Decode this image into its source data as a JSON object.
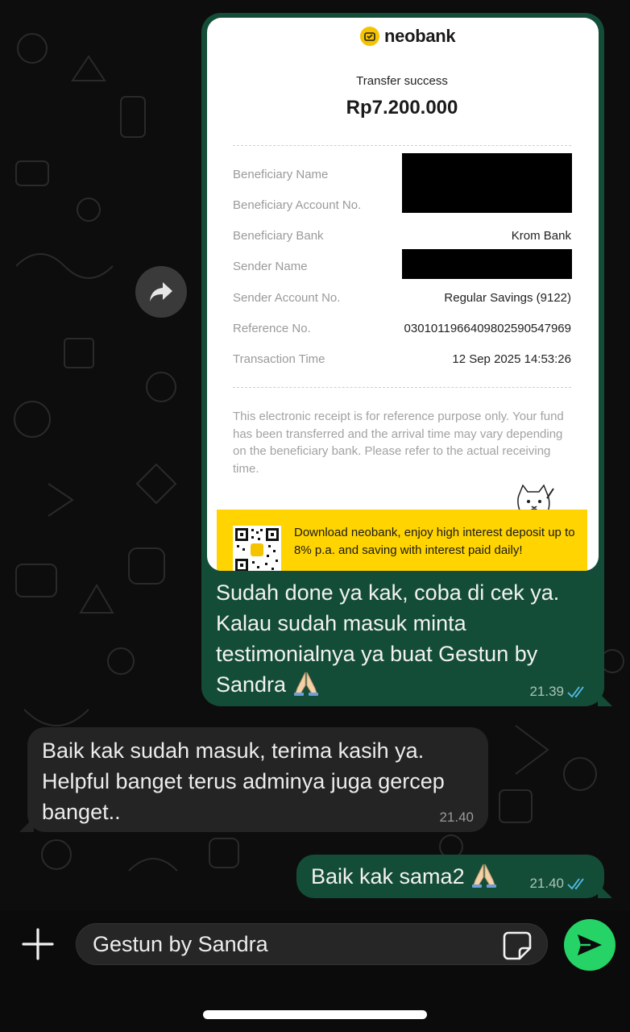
{
  "colors": {
    "outgoing_bubble": "#144d37",
    "incoming_bubble": "#242424",
    "send_button": "#25d366",
    "read_ticks": "#53bdeb",
    "promo_yellow": "#ffd400"
  },
  "receipt": {
    "brand": "neobank",
    "status": "Transfer success",
    "amount": "Rp7.200.000",
    "rows": [
      {
        "label": "Beneficiary Name",
        "value": ""
      },
      {
        "label": "Beneficiary Account No.",
        "value": ""
      },
      {
        "label": "Beneficiary Bank",
        "value": "Krom Bank"
      },
      {
        "label": "Sender Name",
        "value": ""
      },
      {
        "label": "Sender Account No.",
        "value": "Regular Savings (9122)"
      },
      {
        "label": "Reference No.",
        "value": "0301011966409802590547969"
      },
      {
        "label": "Transaction Time",
        "value": "12 Sep 2025 14:53:26"
      }
    ],
    "disclaimer": "This electronic receipt is for reference purpose only. Your fund has been transferred and the arrival time may vary depending on the beneficiary bank. Please refer to the actual receiving time.",
    "promo": "Download neobank, enjoy high interest deposit up to 8% p.a. and saving with interest paid daily!"
  },
  "messages": [
    {
      "direction": "out",
      "text": "Sudah done ya kak, coba di cek ya. Kalau sudah masuk minta testimonialnya ya buat Gestun by Sandra",
      "emoji": "folded-hands",
      "time": "21.39",
      "status": "read"
    },
    {
      "direction": "in",
      "text": "Baik kak sudah masuk, terima kasih ya. Helpful banget terus adminya juga gercep banget..",
      "time": "21.40"
    },
    {
      "direction": "out",
      "text": "Baik kak sama2",
      "emoji": "folded-hands",
      "time": "21.40",
      "status": "read"
    }
  ],
  "composer": {
    "input_value": "Gestun by Sandra",
    "plus_icon": "plus-icon",
    "sticker_icon": "sticker-icon",
    "send_icon": "send-icon"
  }
}
